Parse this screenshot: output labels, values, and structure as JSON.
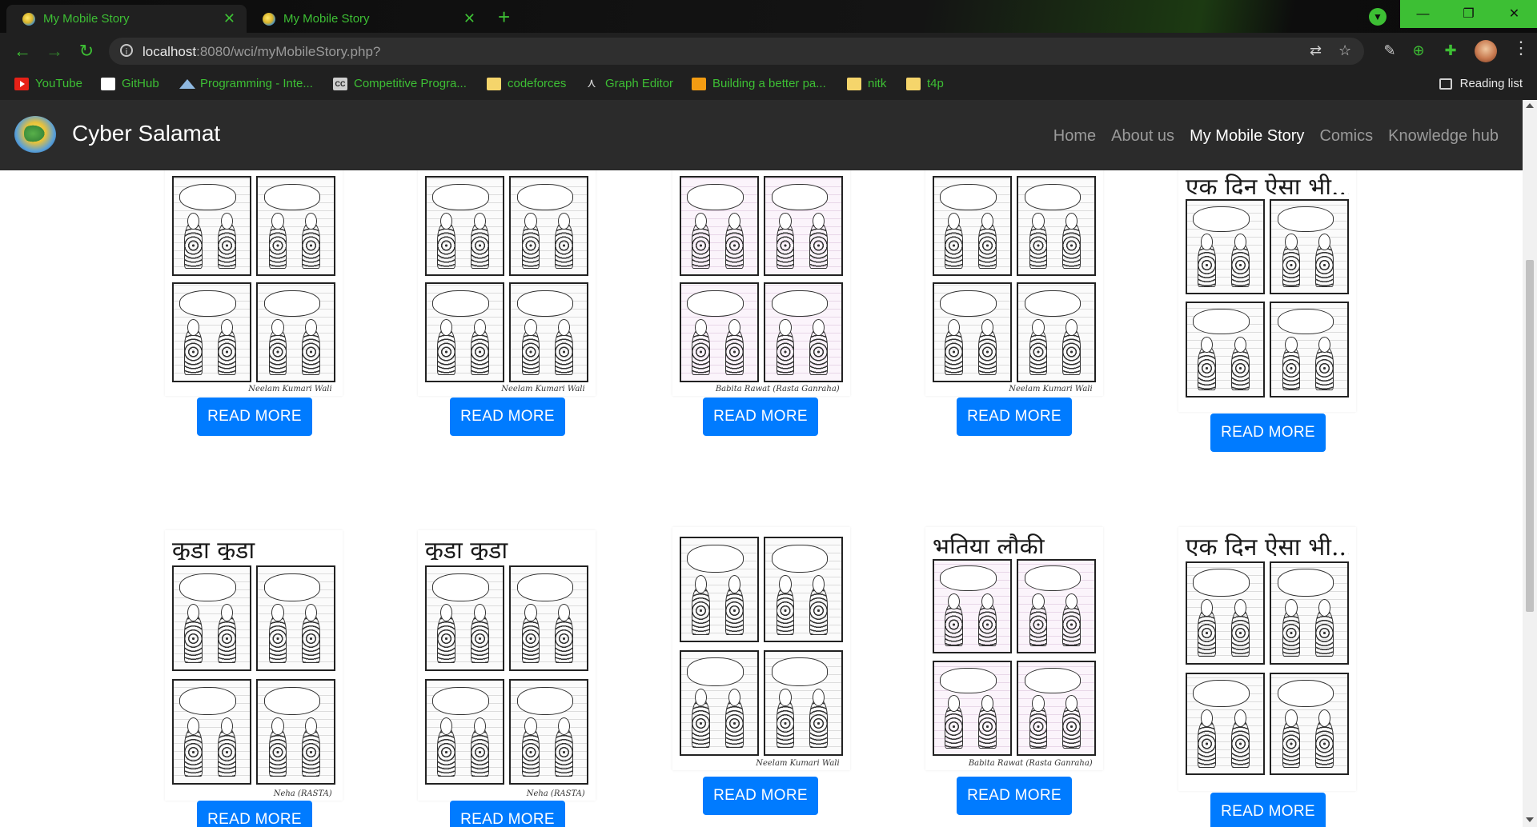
{
  "browser": {
    "tabs": [
      {
        "title": "My Mobile Story",
        "active": true
      },
      {
        "title": "My Mobile Story",
        "active": false
      }
    ],
    "new_tab_symbol": "+",
    "window_controls": {
      "minimize": "—",
      "restore": "❐",
      "close": "✕"
    },
    "url_host": "localhost",
    "url_rest": ":8080/wci/myMobileStory.php?",
    "accent_color": "#3dbf34",
    "bookmarks": [
      {
        "label": "YouTube",
        "icon": "youtube-icon"
      },
      {
        "label": "GitHub",
        "icon": "github-icon"
      },
      {
        "label": "Programming - Inte...",
        "icon": "mountain-icon"
      },
      {
        "label": "Competitive Progra...",
        "icon": "cc-icon"
      },
      {
        "label": "codeforces",
        "icon": "folder-icon"
      },
      {
        "label": "Graph Editor",
        "icon": "graph-icon"
      },
      {
        "label": "Building a better pa...",
        "icon": "orange-icon"
      },
      {
        "label": "nitk",
        "icon": "folder-icon"
      },
      {
        "label": "t4p",
        "icon": "folder-icon"
      }
    ],
    "reading_list": "Reading list"
  },
  "site": {
    "brand": "Cyber Salamat",
    "nav": [
      {
        "label": "Home",
        "active": false
      },
      {
        "label": "About us",
        "active": false
      },
      {
        "label": "My Mobile Story",
        "active": true
      },
      {
        "label": "Comics",
        "active": false
      },
      {
        "label": "Knowledge hub",
        "active": false
      }
    ],
    "button_color": "#007bff",
    "cards": [
      {
        "button": "READ MORE",
        "style": "plain",
        "title_art": "",
        "signature": "Neelam Kumari Wali"
      },
      {
        "button": "READ MORE",
        "style": "plain",
        "title_art": "",
        "signature": "Neelam Kumari Wali"
      },
      {
        "button": "READ MORE",
        "style": "pink",
        "title_art": "",
        "signature": "Babita Rawat (Rasta Ganraha)"
      },
      {
        "button": "READ MORE",
        "style": "plain",
        "title_art": "",
        "signature": "Neelam Kumari Wali"
      },
      {
        "button": "READ MORE",
        "style": "plain",
        "title_art": "एक दिन ऐसा भी...",
        "signature": ""
      },
      {
        "button": "READ MORE",
        "style": "plain",
        "title_art": "कूड़ा कूड़ा",
        "signature": "Neha (RASTA)"
      },
      {
        "button": "READ MORE",
        "style": "plain",
        "title_art": "कूड़ा कूड़ा",
        "signature": "Neha (RASTA)"
      },
      {
        "button": "READ MORE",
        "style": "plain",
        "title_art": "",
        "signature": "Neelam Kumari Wali"
      },
      {
        "button": "READ MORE",
        "style": "pink",
        "title_art": "भूतिया लौकी",
        "signature": "Babita Rawat (Rasta Ganraha)"
      },
      {
        "button": "READ MORE",
        "style": "plain",
        "title_art": "एक दिन ऐसा भी...",
        "signature": ""
      }
    ]
  }
}
